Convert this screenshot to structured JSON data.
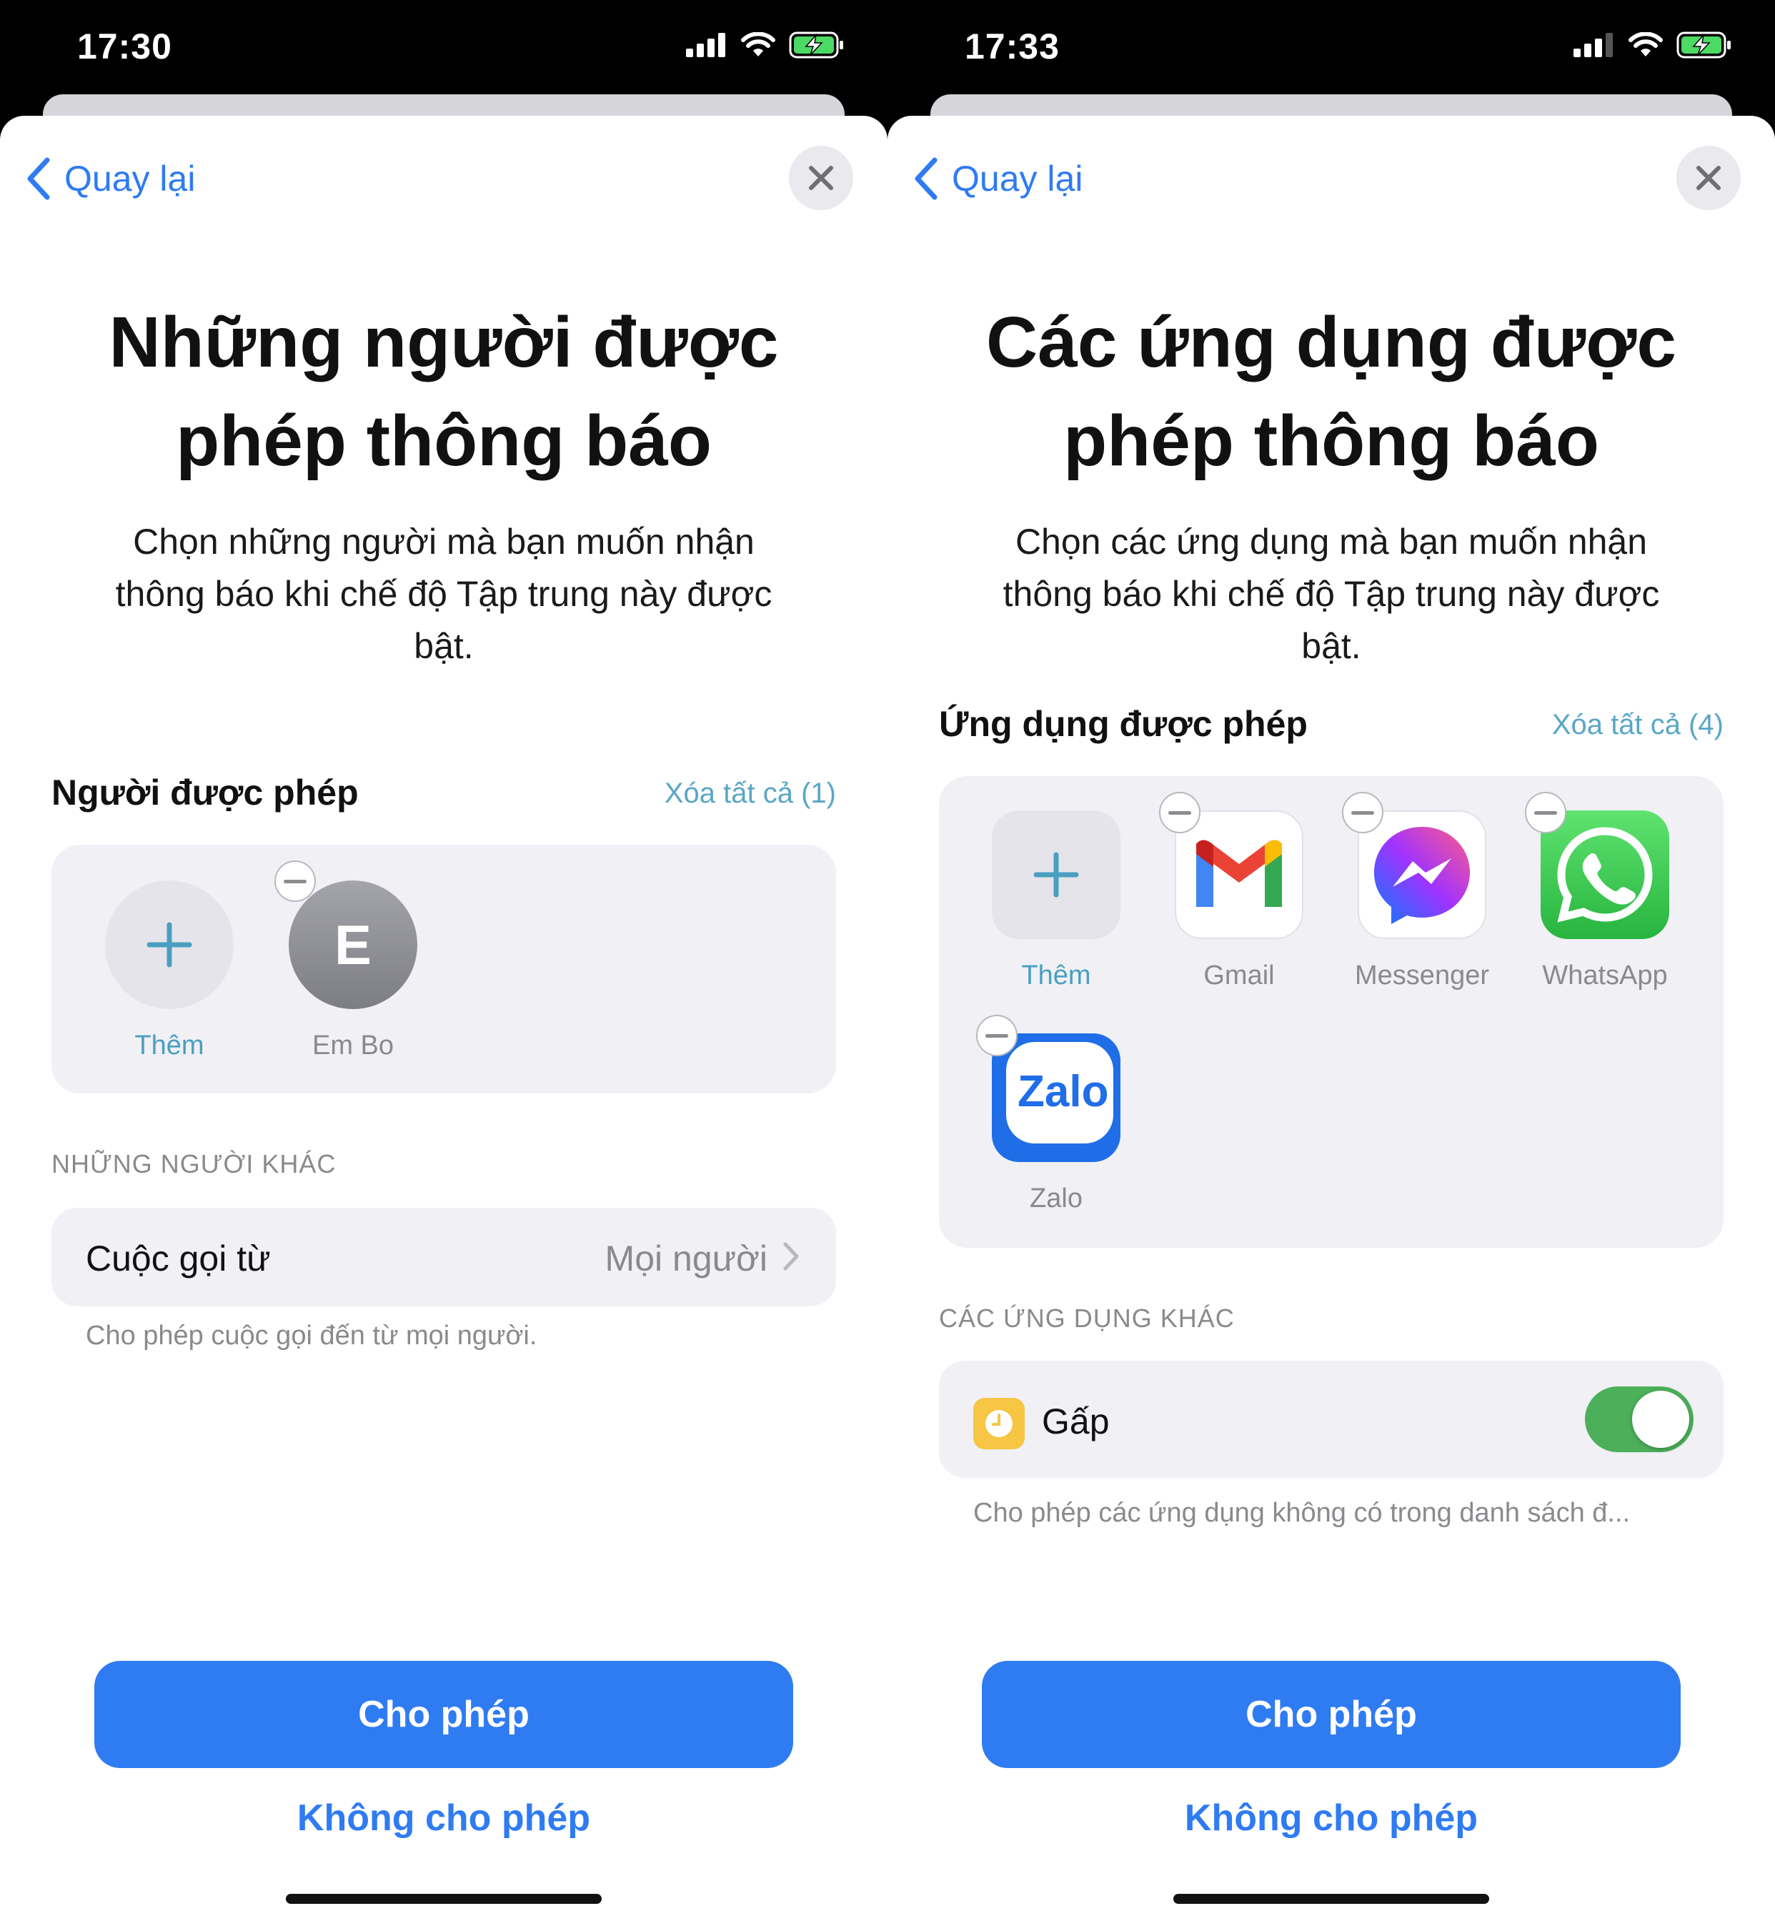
{
  "screens": [
    {
      "status_time": "17:30",
      "back_label": "Quay lại",
      "title_line1": "Những người được",
      "title_line2": "phép thông báo",
      "subtitle_line1": "Chọn những người mà bạn muốn nhận",
      "subtitle_line2": "thông báo khi chế độ Tập trung này được",
      "subtitle_line3": "bật.",
      "section_title": "Người được phép",
      "clear_all": "Xóa tất cả (1)",
      "add_label": "Thêm",
      "contact_initial": "E",
      "contact_name": "Em Bo",
      "other_header": "NHỮNG NGƯỜI KHÁC",
      "calls_label": "Cuộc gọi từ",
      "calls_value": "Mọi người",
      "calls_footnote": "Cho phép cuộc gọi đến từ mọi người.",
      "allow_button": "Cho phép",
      "deny_button": "Không cho phép"
    },
    {
      "status_time": "17:33",
      "back_label": "Quay lại",
      "title_line1": "Các ứng dụng được",
      "title_line2": "phép thông báo",
      "subtitle_line1": "Chọn các ứng dụng mà bạn muốn nhận",
      "subtitle_line2": "thông báo khi chế độ Tập trung này được",
      "subtitle_line3": "bật.",
      "section_title": "Ứng dụng được phép",
      "clear_all": "Xóa tất cả (4)",
      "add_label": "Thêm",
      "apps": [
        {
          "name": "Gmail",
          "icon": "gmail-icon"
        },
        {
          "name": "Messenger",
          "icon": "messenger-icon"
        },
        {
          "name": "WhatsApp",
          "icon": "whatsapp-icon"
        },
        {
          "name": "Zalo",
          "icon": "zalo-icon",
          "icon_text": "Zalo"
        }
      ],
      "other_header": "CÁC ỨNG DỤNG KHÁC",
      "urgent_label": "Gấp",
      "urgent_toggle_on": true,
      "urgent_footnote": "Cho phép các ứng dụng không có trong danh sách đ...",
      "allow_button": "Cho phép",
      "deny_button": "Không cho phép"
    }
  ],
  "colors": {
    "accent": "#2f7bf2",
    "teal_link": "#5aa6c5",
    "toggle_on": "#4caf5a",
    "card_bg": "#f0f0f5"
  }
}
